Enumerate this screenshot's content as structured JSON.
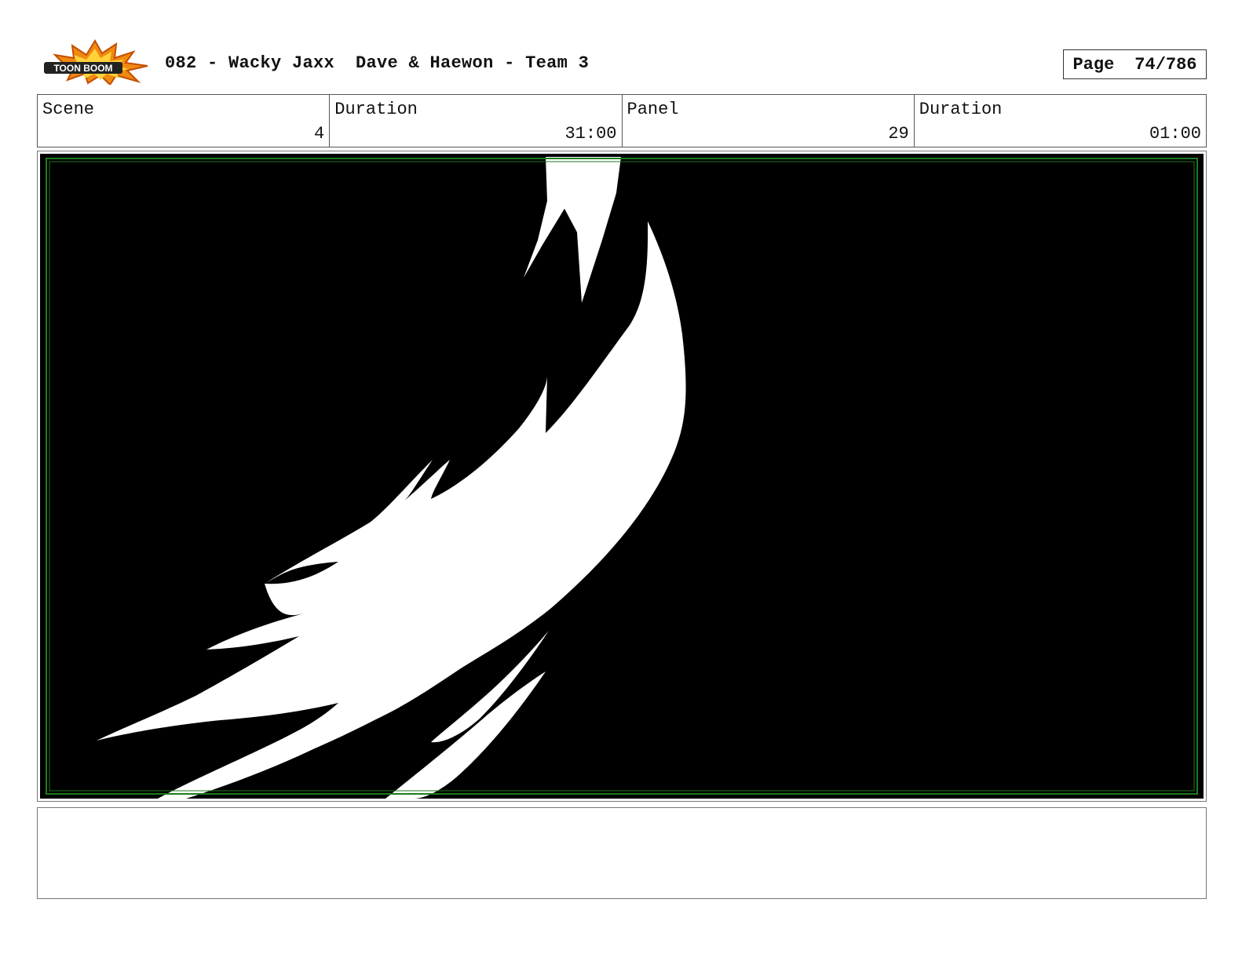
{
  "header": {
    "logo_text": "TOON BOOM",
    "title": "082 - Wacky Jaxx  Dave & Haewon - Team 3",
    "page_label": "Page",
    "page_number": "74/786"
  },
  "info": {
    "scene_label": "Scene",
    "scene_value": "4",
    "scene_duration_label": "Duration",
    "scene_duration_value": "31:00",
    "panel_label": "Panel",
    "panel_value": "29",
    "panel_duration_label": "Duration",
    "panel_duration_value": "01:00"
  },
  "panel_image": {
    "background": "#000000",
    "foreground": "#ffffff",
    "safe_frame_color": "#1e7a1e"
  },
  "notes": {
    "text": ""
  }
}
